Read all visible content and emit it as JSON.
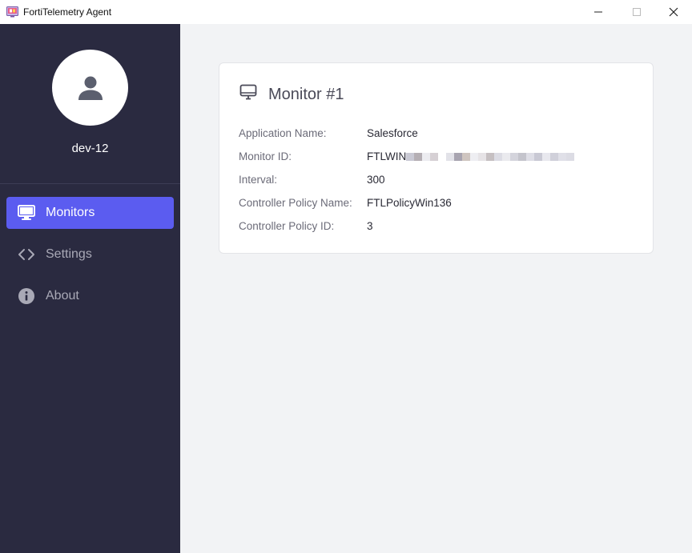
{
  "window": {
    "title": "FortiTelemetry Agent",
    "controls": {
      "minimize": "—",
      "maximize": "☐",
      "close": "✕"
    }
  },
  "sidebar": {
    "username": "dev-12",
    "items": [
      {
        "label": "Monitors",
        "icon": "monitor-icon",
        "active": true
      },
      {
        "label": "Settings",
        "icon": "code-icon",
        "active": false
      },
      {
        "label": "About",
        "icon": "info-icon",
        "active": false
      }
    ]
  },
  "monitor_card": {
    "title": "Monitor #1",
    "fields": [
      {
        "label": "Application Name:",
        "value": "Salesforce"
      },
      {
        "label": "Monitor ID:",
        "value": "FTLWIN"
      },
      {
        "label": "Interval:",
        "value": "300"
      },
      {
        "label": "Controller Policy Name:",
        "value": "FTLPolicyWin136"
      },
      {
        "label": "Controller Policy ID:",
        "value": "3"
      }
    ]
  },
  "colors": {
    "sidebar_bg": "#2a2a40",
    "accent": "#5b5cf0",
    "page_bg": "#f2f3f5"
  }
}
